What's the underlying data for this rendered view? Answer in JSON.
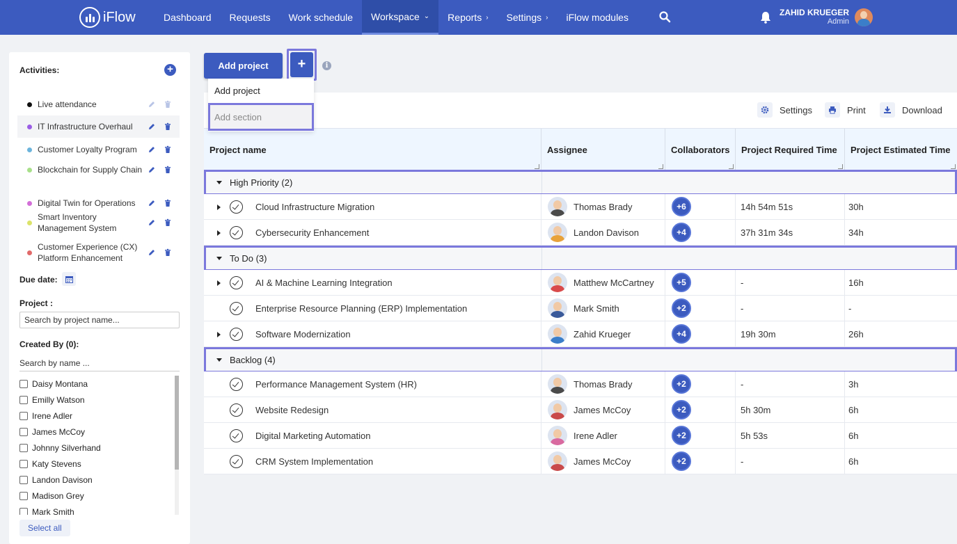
{
  "nav": {
    "brand": "iFlow",
    "items": [
      {
        "label": "Dashboard",
        "chev": ""
      },
      {
        "label": "Requests",
        "chev": ""
      },
      {
        "label": "Work schedule",
        "chev": ""
      },
      {
        "label": "Workspace",
        "chev": "⌄",
        "active": true
      },
      {
        "label": "Reports",
        "chev": "›"
      },
      {
        "label": "Settings",
        "chev": "›"
      },
      {
        "label": "iFlow modules",
        "chev": ""
      }
    ],
    "user_name": "ZAHID KRUEGER",
    "user_role": "Admin"
  },
  "sidebar": {
    "activities_title": "Activities:",
    "activities": [
      {
        "label": "Live attendance",
        "color": "#111111"
      },
      {
        "label": "IT Infrastructure Overhaul",
        "color": "#9b5de5"
      },
      {
        "label": "Customer Loyalty Program",
        "color": "#6cb4dc"
      },
      {
        "label": "Blockchain for Supply Chain",
        "color": "#a8e08a"
      },
      {
        "label": "Digital Twin for Operations",
        "color": "#d36fd8"
      },
      {
        "label": "Smart Inventory Management System",
        "color": "#dbe36a"
      },
      {
        "label": "Customer Experience (CX) Platform Enhancement",
        "color": "#e16a6a"
      }
    ],
    "due_date_label": "Due date:",
    "project_label": "Project :",
    "project_placeholder": "Search by project name...",
    "created_by_label": "Created By (0):",
    "created_by_placeholder": "Search by name ...",
    "people": [
      "Daisy Montana",
      "Emilly Watson",
      "Irene Adler",
      "James McCoy",
      "Johnny Silverhand",
      "Katy Stevens",
      "Landon Davison",
      "Madison Grey",
      "Mark Smith"
    ],
    "select_all": "Select all"
  },
  "toolbar": {
    "add_project": "Add project",
    "plus": "+",
    "info": "i",
    "dropdown_add_project": "Add project",
    "dropdown_add_section": "Add section"
  },
  "actions": {
    "settings": "Settings",
    "print": "Print",
    "download": "Download"
  },
  "table": {
    "headers": {
      "project_name": "Project name",
      "assignee": "Assignee",
      "collaborators": "Collaborators",
      "required_time": "Project Required Time",
      "estimated_time": "Project Estimated Time"
    },
    "sections": [
      {
        "name": "High Priority (2)",
        "rows": [
          {
            "name": "Cloud Infrastructure Migration",
            "expandable": true,
            "assignee": "Thomas Brady",
            "collab": "+6",
            "required": "14h 54m 51s",
            "estimated": "30h",
            "shirt": "#4a4a4a"
          },
          {
            "name": "Cybersecurity Enhancement",
            "expandable": true,
            "assignee": "Landon Davison",
            "collab": "+4",
            "required": "37h 31m 34s",
            "estimated": "34h",
            "shirt": "#e8a23a"
          }
        ]
      },
      {
        "name": "To Do (3)",
        "rows": [
          {
            "name": "AI & Machine Learning Integration",
            "expandable": true,
            "assignee": "Matthew McCartney",
            "collab": "+5",
            "required": "-",
            "estimated": "16h",
            "shirt": "#d94a4a"
          },
          {
            "name": "Enterprise Resource Planning (ERP) Implementation",
            "expandable": false,
            "assignee": "Mark Smith",
            "collab": "+2",
            "required": "-",
            "estimated": "-",
            "shirt": "#3a5a9a"
          },
          {
            "name": "Software Modernization",
            "expandable": true,
            "assignee": "Zahid Krueger",
            "collab": "+4",
            "required": "19h 30m",
            "estimated": "26h",
            "shirt": "#3b7ec9"
          }
        ]
      },
      {
        "name": "Backlog (4)",
        "rows": [
          {
            "name": "Performance Management System (HR)",
            "expandable": false,
            "assignee": "Thomas Brady",
            "collab": "+2",
            "required": "-",
            "estimated": "3h",
            "shirt": "#4a4a4a"
          },
          {
            "name": "Website Redesign",
            "expandable": false,
            "assignee": "James McCoy",
            "collab": "+2",
            "required": "5h 30m",
            "estimated": "6h",
            "shirt": "#c94a4a"
          },
          {
            "name": "Digital Marketing Automation",
            "expandable": false,
            "assignee": "Irene Adler",
            "collab": "+2",
            "required": "5h 53s",
            "estimated": "6h",
            "shirt": "#d96aa0"
          },
          {
            "name": "CRM System Implementation",
            "expandable": false,
            "assignee": "James McCoy",
            "collab": "+2",
            "required": "-",
            "estimated": "6h",
            "shirt": "#c94a4a"
          }
        ]
      }
    ]
  },
  "colors": {
    "primary": "#3c5bbf",
    "highlight": "#7b78dc"
  }
}
